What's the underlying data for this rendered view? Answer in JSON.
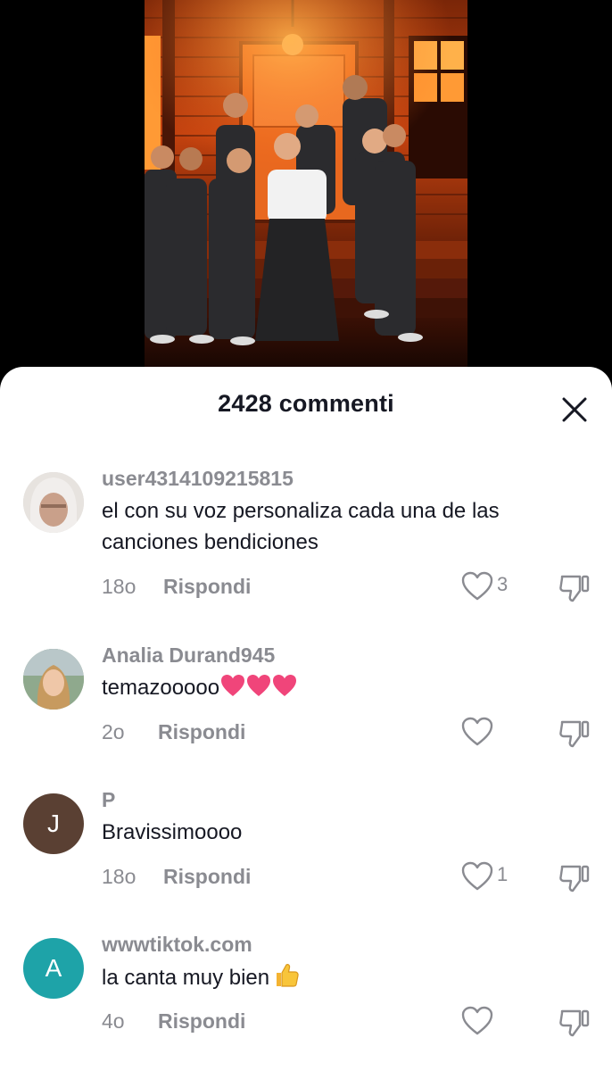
{
  "sheet": {
    "title": "2428 commenti"
  },
  "comments": [
    {
      "username": "user4314109215815",
      "text": "el con su voz personaliza cada una de las canciones bendiciones",
      "time": "18o",
      "reply_label": "Rispondi",
      "likes": "3",
      "avatar_type": "photo"
    },
    {
      "username": "Analia Durand945",
      "text": "temazooooo",
      "emoji": "three-pink-hearts",
      "time": "2o",
      "reply_label": "Rispondi",
      "likes": "",
      "avatar_type": "photo"
    },
    {
      "username": "P",
      "text": "Bravissimoooo",
      "time": "18o",
      "reply_label": "Rispondi",
      "likes": "1",
      "avatar_letter": "J",
      "avatar_color": "#5a4033"
    },
    {
      "username": "wwwtiktok.com",
      "text": "la canta muy bien",
      "emoji": "thumbs-up",
      "time": "4o",
      "reply_label": "Rispondi",
      "likes": "",
      "avatar_letter": "A",
      "avatar_color": "#1ea3a8"
    }
  ],
  "colors": {
    "text_primary": "#161823",
    "text_secondary": "#8a8b91",
    "stage_orange": "#d9581a",
    "heart_pink": "#f0457a"
  },
  "icons": {
    "close": "close-icon",
    "like": "heart-outline-icon",
    "dislike": "thumbs-down-icon"
  }
}
